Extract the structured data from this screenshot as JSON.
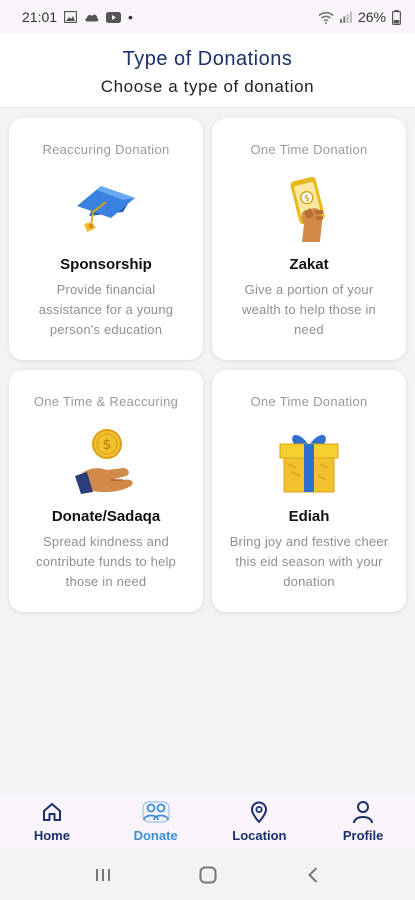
{
  "status_bar": {
    "time": "21:01",
    "dot": "•",
    "battery": "26%"
  },
  "header": {
    "title": "Type of Donations",
    "subtitle": "Choose a type of donation"
  },
  "cards": [
    {
      "type": "Reaccuring Donation",
      "title": "Sponsorship",
      "description": "Provide financial assistance for a young person's education",
      "icon": "graduation-cap-icon"
    },
    {
      "type": "One Time Donation",
      "title": "Zakat",
      "description": "Give a portion of your wealth to help those in need",
      "icon": "phone-in-hand-icon"
    },
    {
      "type": "One Time & Reaccuring",
      "title": "Donate/Sadaqa",
      "description": "Spread kindness and contribute funds to help those in need",
      "icon": "coin-in-hand-icon"
    },
    {
      "type": "One Time Donation",
      "title": "Ediah",
      "description": "Bring joy and festive cheer this eid season with your donation",
      "icon": "gift-box-icon"
    }
  ],
  "nav": {
    "active": "Donate",
    "items": [
      {
        "label": "Home",
        "icon": "home-icon"
      },
      {
        "label": "Donate",
        "icon": "people-icon"
      },
      {
        "label": "Location",
        "icon": "location-pin-icon"
      },
      {
        "label": "Profile",
        "icon": "person-icon"
      }
    ]
  },
  "colors": {
    "brand_navy": "#1b2f6b",
    "active_blue": "#3a8fd6",
    "background": "#f3f3f5"
  }
}
